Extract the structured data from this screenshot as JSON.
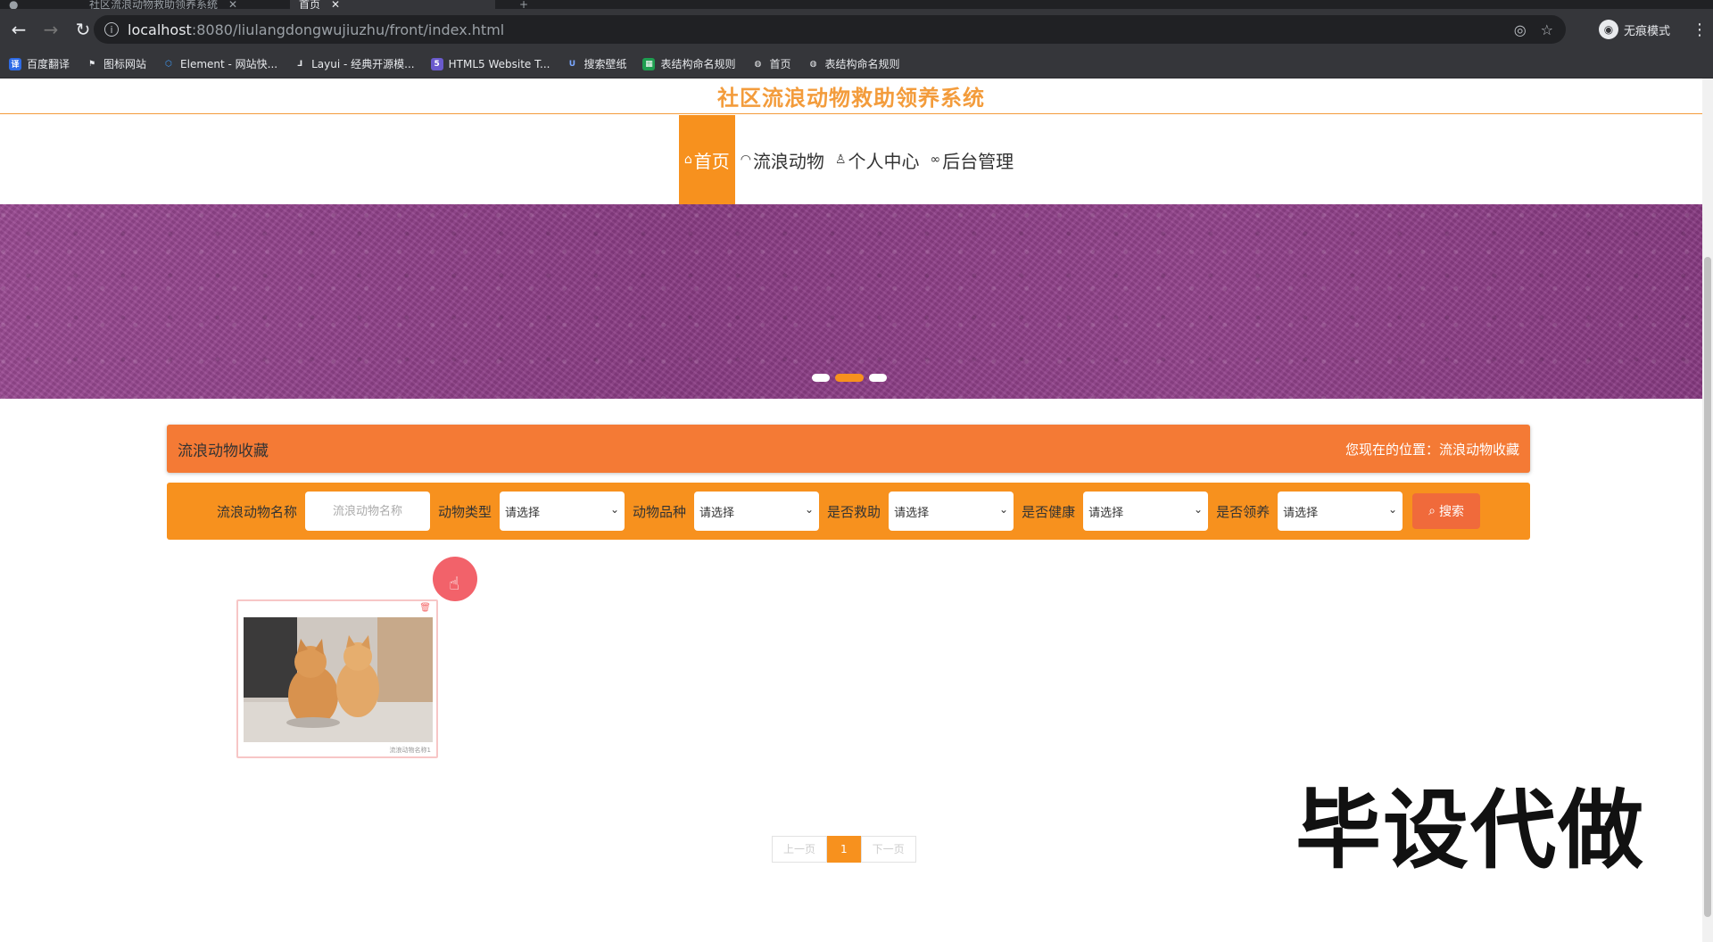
{
  "browser": {
    "tabs": [
      {
        "label": "社区流浪动物救助领养系统",
        "active": false
      },
      {
        "label": "首页",
        "active": true
      }
    ],
    "url_host": "localhost",
    "url_path": ":8080/liulangdongwujiuzhu/front/index.html",
    "profile_label": "无痕模式",
    "bookmarks": [
      {
        "label": "百度翻译",
        "icon": "translate-icon",
        "color": "#2e6be6"
      },
      {
        "label": "图标网站",
        "icon": "flag-icon",
        "color": "#444444"
      },
      {
        "label": "Element - 网站快...",
        "icon": "element-icon",
        "color": "#409eff"
      },
      {
        "label": "Layui - 经典开源模...",
        "icon": "layui-icon",
        "color": "#555555"
      },
      {
        "label": "HTML5 Website T...",
        "icon": "html5-icon",
        "color": "#6a5acd"
      },
      {
        "label": "搜索壁纸",
        "icon": "wallpaper-icon",
        "color": "#4a7bd0"
      },
      {
        "label": "表结构命名规则",
        "icon": "sheet-icon",
        "color": "#1e9e50"
      },
      {
        "label": "首页",
        "icon": "globe-icon",
        "color": "#777777"
      },
      {
        "label": "表结构命名规则",
        "icon": "globe-icon",
        "color": "#777777"
      }
    ]
  },
  "site": {
    "title": "社区流浪动物救助领养系统",
    "accent": "#f7911e"
  },
  "nav": [
    {
      "label": "首页",
      "icon": "home-icon",
      "active": true
    },
    {
      "label": "流浪动物",
      "icon": "dashboard-icon",
      "active": false
    },
    {
      "label": "个人中心",
      "icon": "user-icon",
      "active": false
    },
    {
      "label": "后台管理",
      "icon": "link-icon",
      "active": false
    }
  ],
  "banner": {
    "active_slide": 2,
    "slide_count": 3
  },
  "breadcrumb": {
    "title": "流浪动物收藏",
    "position": "您现在的位置：流浪动物收藏"
  },
  "search": {
    "name_label": "流浪动物名称",
    "name_placeholder": "流浪动物名称",
    "filters": [
      {
        "label": "动物类型",
        "value": "请选择"
      },
      {
        "label": "动物品种",
        "value": "请选择"
      },
      {
        "label": "是否救助",
        "value": "请选择"
      },
      {
        "label": "是否健康",
        "value": "请选择"
      },
      {
        "label": "是否领养",
        "value": "请选择"
      }
    ],
    "button_label": "搜索"
  },
  "cards": [
    {
      "caption": "流浪动物名称1",
      "image": "two-orange-cats"
    }
  ],
  "pager": {
    "prev": "上一页",
    "current": "1",
    "next": "下一页"
  },
  "watermark": "毕设代做"
}
